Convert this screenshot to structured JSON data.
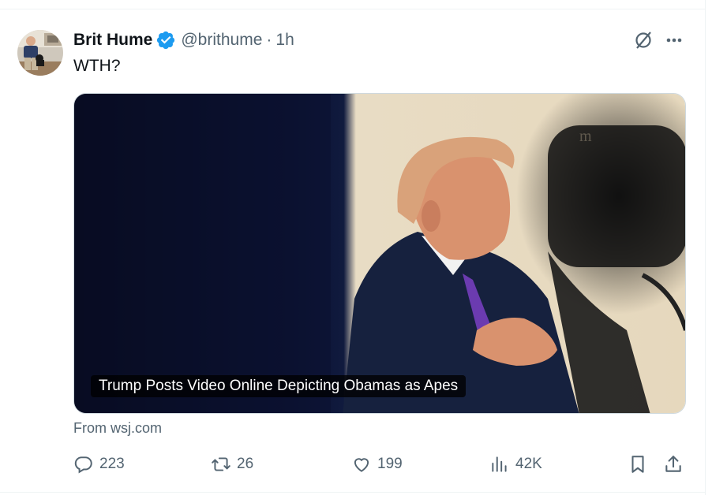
{
  "tweet": {
    "display_name": "Brit Hume",
    "handle": "@brithume",
    "separator": "·",
    "time": "1h",
    "text": "WTH?",
    "avatar_icon": "avatar-photo",
    "verified_color": "#1d9bf0"
  },
  "card": {
    "title": "Trump Posts Video Online Depicting Obamas as Apes",
    "source": "From wsj.com",
    "image": "news-photo"
  },
  "actions": {
    "replies": "223",
    "retweets": "26",
    "likes": "199",
    "views": "42K",
    "reply_icon": "reply-icon",
    "retweet_icon": "retweet-icon",
    "like_icon": "heart-icon",
    "views_icon": "analytics-icon",
    "bookmark_icon": "bookmark-icon",
    "share_icon": "share-icon"
  },
  "colors": {
    "text_primary": "#0f1419",
    "text_secondary": "#536471",
    "border": "#eff3f4",
    "accent": "#1d9bf0"
  }
}
